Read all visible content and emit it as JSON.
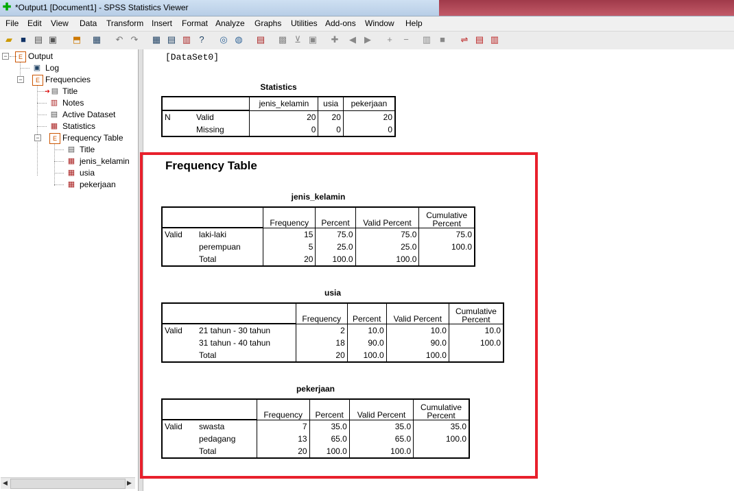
{
  "window": {
    "title": "*Output1 [Document1] - SPSS Statistics Viewer"
  },
  "menu": [
    "File",
    "Edit",
    "View",
    "Data",
    "Transform",
    "Insert",
    "Format",
    "Analyze",
    "Graphs",
    "Utilities",
    "Add-ons",
    "Window",
    "Help"
  ],
  "toolbar": {
    "icons": [
      "open-icon",
      "save-icon",
      "print-icon",
      "print-preview-icon",
      "export-icon",
      "go-to-data-icon",
      "undo-icon",
      "redo-icon",
      "variables-icon",
      "goto-case-icon",
      "insert-cases-icon",
      "find-icon",
      "select-cases-icon",
      "split-file-icon",
      "weight-cases-icon",
      "value-labels-icon",
      "add-icon",
      "back-icon",
      "forward-icon",
      "expand-icon",
      "collapse-icon",
      "show-icon",
      "hide-icon",
      "insert-heading-icon",
      "insert-title-icon",
      "insert-text-icon"
    ]
  },
  "navigator": {
    "items": [
      {
        "label": "Output"
      },
      {
        "label": "Log"
      },
      {
        "label": "Frequencies"
      },
      {
        "label": "Title"
      },
      {
        "label": "Notes"
      },
      {
        "label": "Active Dataset"
      },
      {
        "label": "Statistics"
      },
      {
        "label": "Frequency Table"
      },
      {
        "label": "Title"
      },
      {
        "label": "jenis_kelamin"
      },
      {
        "label": "usia"
      },
      {
        "label": "pekerjaan"
      }
    ]
  },
  "output": {
    "dataset_label": "[DataSet0]",
    "statistics": {
      "title": "Statistics",
      "columns": [
        "jenis_kelamin",
        "usia",
        "pekerjaan"
      ],
      "group": "N",
      "rows": [
        {
          "label": "Valid",
          "values": [
            "20",
            "20",
            "20"
          ]
        },
        {
          "label": "Missing",
          "values": [
            "0",
            "0",
            "0"
          ]
        }
      ]
    },
    "frequency_heading": "Frequency Table",
    "headers": {
      "frequency": "Frequency",
      "percent": "Percent",
      "valid_percent": "Valid Percent",
      "cumulative_1": "Cumulative",
      "cumulative_2": "Percent",
      "valid": "Valid"
    },
    "tables": [
      {
        "title": "jenis_kelamin",
        "rows": [
          {
            "label": "laki-laki",
            "freq": "15",
            "pct": "75.0",
            "vpct": "75.0",
            "cum": "75.0"
          },
          {
            "label": "perempuan",
            "freq": "5",
            "pct": "25.0",
            "vpct": "25.0",
            "cum": "100.0"
          },
          {
            "label": "Total",
            "freq": "20",
            "pct": "100.0",
            "vpct": "100.0",
            "cum": ""
          }
        ]
      },
      {
        "title": "usia",
        "rows": [
          {
            "label": "21 tahun - 30 tahun",
            "freq": "2",
            "pct": "10.0",
            "vpct": "10.0",
            "cum": "10.0"
          },
          {
            "label": "31 tahun - 40 tahun",
            "freq": "18",
            "pct": "90.0",
            "vpct": "90.0",
            "cum": "100.0"
          },
          {
            "label": "Total",
            "freq": "20",
            "pct": "100.0",
            "vpct": "100.0",
            "cum": ""
          }
        ]
      },
      {
        "title": "pekerjaan",
        "rows": [
          {
            "label": "swasta",
            "freq": "7",
            "pct": "35.0",
            "vpct": "35.0",
            "cum": "35.0"
          },
          {
            "label": "pedagang",
            "freq": "13",
            "pct": "65.0",
            "vpct": "65.0",
            "cum": "100.0"
          },
          {
            "label": "Total",
            "freq": "20",
            "pct": "100.0",
            "vpct": "100.0",
            "cum": ""
          }
        ]
      }
    ]
  }
}
